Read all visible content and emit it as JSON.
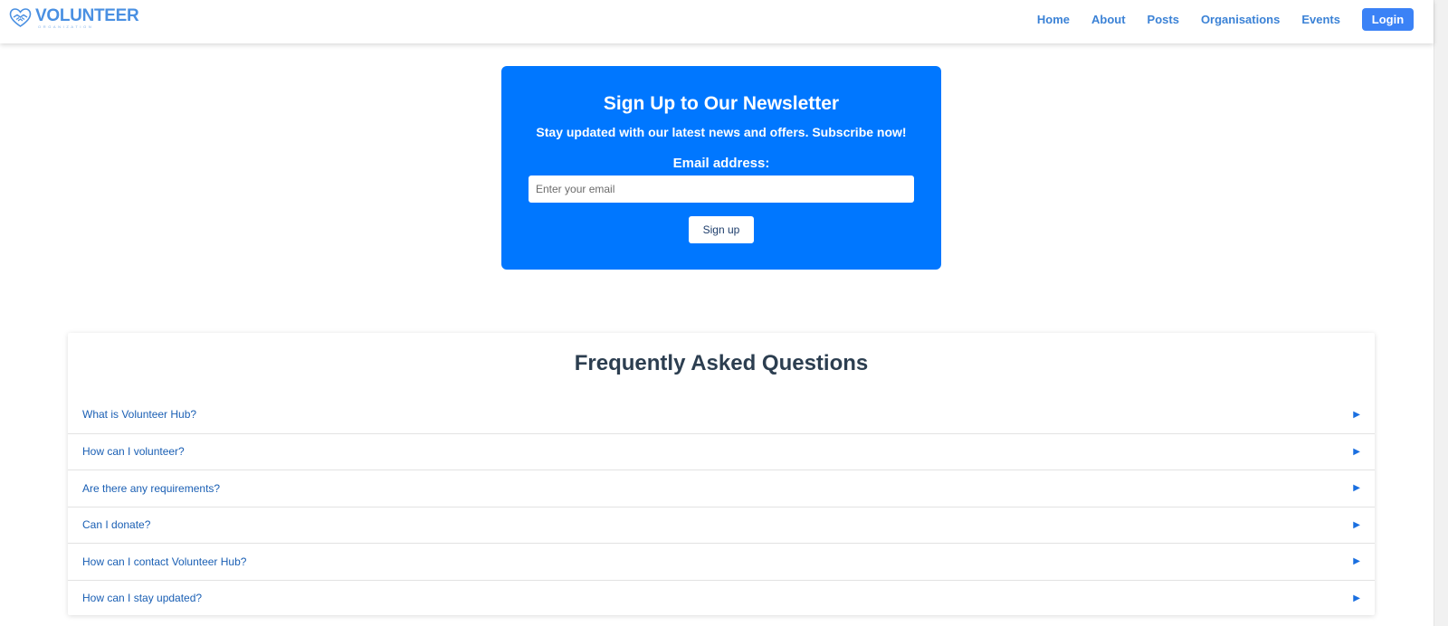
{
  "header": {
    "logo": {
      "word": "VOLUNTEER",
      "sub": "ORGANIZATION",
      "icon": "heart-hands-icon"
    },
    "nav": [
      "Home",
      "About",
      "Posts",
      "Organisations",
      "Events"
    ],
    "login_label": "Login"
  },
  "newsletter": {
    "title": "Sign Up to Our Newsletter",
    "subtitle": "Stay updated with our latest news and offers. Subscribe now!",
    "email_label": "Email address:",
    "email_placeholder": "Enter your email",
    "email_value": "",
    "button_label": "Sign up"
  },
  "faq": {
    "title": "Frequently Asked Questions",
    "arrow_icon": "triangle-right-icon",
    "items": [
      "What is Volunteer Hub?",
      "How can I volunteer?",
      "Are there any requirements?",
      "Can I donate?",
      "How can I contact Volunteer Hub?",
      "How can I stay updated?"
    ]
  },
  "colors": {
    "brand": "#4a90e2",
    "newsletter_bg": "#0077ff",
    "login_bg": "#3b82f6",
    "faq_title": "#2c3e50",
    "faq_link": "#1a5fb4"
  }
}
